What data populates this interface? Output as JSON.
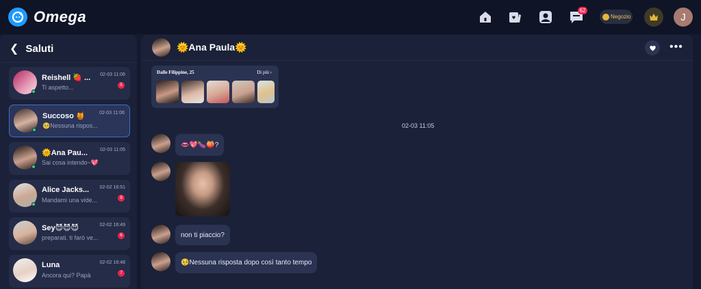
{
  "app": {
    "name": "Omega",
    "shop_label": "Negozio",
    "notification_count": "62",
    "user_initial": "J"
  },
  "nav_icons": [
    "home-icon",
    "cards-icon",
    "profile-icon",
    "chat-icon",
    "coin-icon",
    "crown-icon"
  ],
  "colors": {
    "background": "#151a30",
    "panel": "#1b2138",
    "bubble": "#2b3352",
    "accent": "#1e9bff",
    "badge": "#e8264d",
    "online": "#35d07a"
  },
  "sidebar": {
    "title": "Saluti",
    "conversations": [
      {
        "name": "Reishell 🍓 ...",
        "time": "02-03 11:06",
        "preview": "Ti aspetto...",
        "count": "5"
      },
      {
        "name": "Succoso 🍯",
        "time": "02-03 11:06",
        "preview": "🥺Nessuna rispos...",
        "count": ""
      },
      {
        "name": "🌞Ana Pau...",
        "time": "02-03 11:05",
        "preview": "Sai cosa intendo~💖",
        "count": ""
      },
      {
        "name": "Alice Jacks...",
        "time": "02-02 16:51",
        "preview": "Mandami una vide...",
        "count": "9"
      },
      {
        "name": "Sey😈😈😈",
        "time": "02-02 16:49",
        "preview": "preparati. ti farò ve...",
        "count": "6"
      },
      {
        "name": "Luna",
        "time": "02-02 16:48",
        "preview": "Ancora qui? Papà",
        "count": "7"
      }
    ]
  },
  "chat": {
    "contact_name": "🌞Ana Paula🌞",
    "profile_card": {
      "title": "Dalle Filippine, 25",
      "more_label": "Di più"
    },
    "date_separator": "02-03 11:05",
    "messages": [
      {
        "type": "text",
        "text": "👄💖🍆🍑?"
      },
      {
        "type": "image"
      },
      {
        "type": "text",
        "text": "non ti piaccio?"
      },
      {
        "type": "text",
        "text": "🥺Nessuna risposta dopo così tanto tempo"
      }
    ]
  }
}
